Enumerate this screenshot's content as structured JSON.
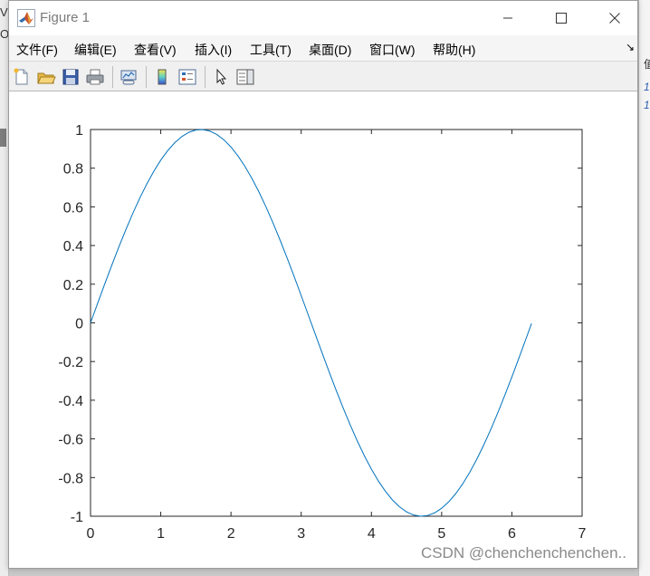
{
  "window": {
    "title": "Figure 1"
  },
  "menu": {
    "items": [
      "文件(F)",
      "编辑(E)",
      "查看(V)",
      "插入(I)",
      "工具(T)",
      "桌面(D)",
      "窗口(W)",
      "帮助(H)"
    ],
    "overflow": "↘"
  },
  "toolbar": {
    "buttons": [
      {
        "icon": "new-figure-icon"
      },
      {
        "icon": "open-file-icon"
      },
      {
        "icon": "save-icon"
      },
      {
        "icon": "print-icon"
      },
      {
        "icon": "link-plot-icon"
      },
      {
        "icon": "insert-colorbar-icon"
      },
      {
        "icon": "insert-legend-icon"
      },
      {
        "icon": "edit-plot-icon"
      },
      {
        "icon": "property-inspector-icon"
      }
    ]
  },
  "background": {
    "left_fragments": [
      "V",
      "O"
    ],
    "right_fragments": [
      "值",
      "1",
      "1"
    ]
  },
  "watermark": "CSDN @chenchenchenchen..",
  "chart_data": {
    "type": "line",
    "title": "",
    "xlabel": "",
    "ylabel": "",
    "xlim": [
      0,
      7
    ],
    "ylim": [
      -1,
      1
    ],
    "xticks": [
      0,
      1,
      2,
      3,
      4,
      5,
      6,
      7
    ],
    "yticks": [
      1,
      0.8,
      0.6,
      0.4,
      0.2,
      0,
      -0.2,
      -0.4,
      -0.6,
      -0.8,
      -1
    ],
    "grid": false,
    "line_color": "#0072BD",
    "series": [
      {
        "x": [
          0,
          0.1,
          0.2,
          0.3,
          0.4,
          0.5,
          0.6,
          0.7,
          0.8,
          0.9,
          1.0,
          1.1,
          1.2,
          1.3,
          1.4,
          1.5,
          1.6,
          1.7,
          1.8,
          1.9,
          2.0,
          2.1,
          2.2,
          2.3,
          2.4,
          2.5,
          2.6,
          2.7,
          2.8,
          2.9,
          3.0,
          3.1,
          3.2,
          3.3,
          3.4,
          3.5,
          3.6,
          3.7,
          3.8,
          3.9,
          4.0,
          4.1,
          4.2,
          4.3,
          4.4,
          4.5,
          4.6,
          4.7,
          4.8,
          4.9,
          5.0,
          5.1,
          5.2,
          5.3,
          5.4,
          5.5,
          5.6,
          5.7,
          5.8,
          5.9,
          6.0,
          6.1,
          6.2,
          6.28
        ],
        "y": [
          0,
          0.0998,
          0.1987,
          0.2955,
          0.3894,
          0.4794,
          0.5646,
          0.6442,
          0.7174,
          0.7833,
          0.8415,
          0.8912,
          0.932,
          0.9636,
          0.9854,
          0.9975,
          0.9996,
          0.9917,
          0.9738,
          0.9463,
          0.9093,
          0.8632,
          0.8085,
          0.7457,
          0.6755,
          0.5985,
          0.5155,
          0.4274,
          0.335,
          0.2392,
          0.1411,
          0.0416,
          -0.0584,
          -0.1577,
          -0.2555,
          -0.3508,
          -0.4425,
          -0.5298,
          -0.6119,
          -0.6878,
          -0.7568,
          -0.8183,
          -0.8716,
          -0.9162,
          -0.9516,
          -0.9775,
          -0.9937,
          -0.9999,
          -0.9962,
          -0.9825,
          -0.9589,
          -0.9258,
          -0.8835,
          -0.8323,
          -0.7728,
          -0.7055,
          -0.6313,
          -0.5507,
          -0.4646,
          -0.3739,
          -0.2794,
          -0.1822,
          -0.0831,
          -0.0032
        ]
      }
    ]
  }
}
